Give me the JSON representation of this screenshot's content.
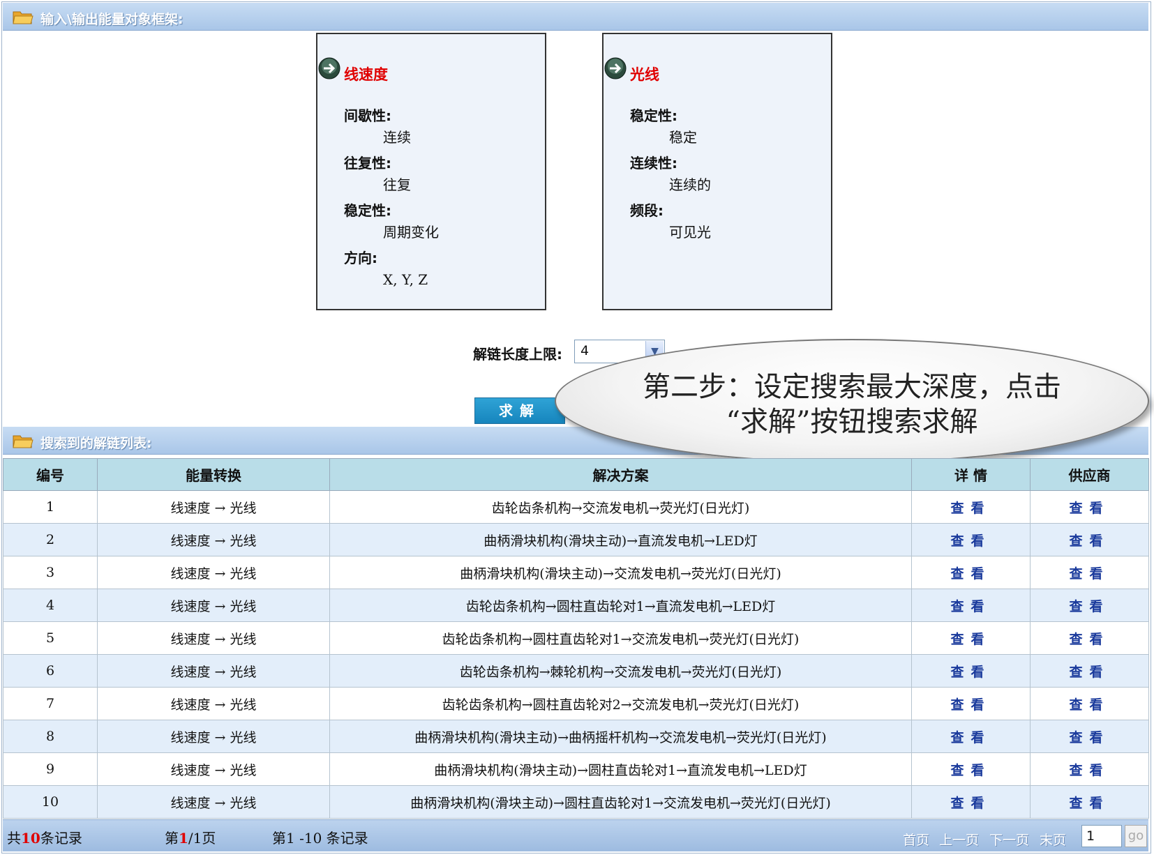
{
  "top_section": {
    "title": "输入\\输出能量对象框架:"
  },
  "input_object": {
    "title": "线速度",
    "properties": [
      {
        "name": "间歇性:",
        "value": "连续"
      },
      {
        "name": "往复性:",
        "value": "往复"
      },
      {
        "name": "稳定性:",
        "value": "周期变化"
      },
      {
        "name": "方向:",
        "value": "X, Y, Z"
      }
    ]
  },
  "output_object": {
    "title": "光线",
    "properties": [
      {
        "name": "稳定性:",
        "value": "稳定"
      },
      {
        "name": "连续性:",
        "value": "连续的"
      },
      {
        "name": "频段:",
        "value": "可见光"
      }
    ]
  },
  "controls": {
    "limit_label": "解链长度上限:",
    "limit_value": "4",
    "solve_label": "求解"
  },
  "callout": {
    "line1": "第二步：设定搜索最大深度，点击",
    "line2": "“求解”按钮搜索求解"
  },
  "results_section": {
    "title": "搜索到的解链列表:"
  },
  "table": {
    "headers": [
      "编号",
      "能量转换",
      "解决方案",
      "详 情",
      "供应商"
    ],
    "link_text": "查看",
    "rows": [
      {
        "id": "1",
        "conversion": "线速度 → 光线",
        "solution": "齿轮齿条机构→交流发电机→荧光灯(日光灯)"
      },
      {
        "id": "2",
        "conversion": "线速度 → 光线",
        "solution": "曲柄滑块机构(滑块主动)→直流发电机→LED灯"
      },
      {
        "id": "3",
        "conversion": "线速度 → 光线",
        "solution": "曲柄滑块机构(滑块主动)→交流发电机→荧光灯(日光灯)"
      },
      {
        "id": "4",
        "conversion": "线速度 → 光线",
        "solution": "齿轮齿条机构→圆柱直齿轮对1→直流发电机→LED灯"
      },
      {
        "id": "5",
        "conversion": "线速度 → 光线",
        "solution": "齿轮齿条机构→圆柱直齿轮对1→交流发电机→荧光灯(日光灯)"
      },
      {
        "id": "6",
        "conversion": "线速度 → 光线",
        "solution": "齿轮齿条机构→棘轮机构→交流发电机→荧光灯(日光灯)"
      },
      {
        "id": "7",
        "conversion": "线速度 → 光线",
        "solution": "齿轮齿条机构→圆柱直齿轮对2→交流发电机→荧光灯(日光灯)"
      },
      {
        "id": "8",
        "conversion": "线速度 → 光线",
        "solution": "曲柄滑块机构(滑块主动)→曲柄摇杆机构→交流发电机→荧光灯(日光灯)"
      },
      {
        "id": "9",
        "conversion": "线速度 → 光线",
        "solution": "曲柄滑块机构(滑块主动)→圆柱直齿轮对1→直流发电机→LED灯"
      },
      {
        "id": "10",
        "conversion": "线速度 → 光线",
        "solution": "曲柄滑块机构(滑块主动)→圆柱直齿轮对1→交流发电机→荧光灯(日光灯)"
      }
    ]
  },
  "footer": {
    "total_prefix": "共",
    "total_count": "10",
    "total_suffix": "条记录",
    "page_prefix": "第",
    "page_current": "1",
    "page_suffix": "/1页",
    "range_text": "第1 -10 条记录",
    "first_page": "首页",
    "prev_page": "上一页",
    "next_page": "下一页",
    "last_page": "末页",
    "page_input_value": "1",
    "go_label": "go"
  },
  "colors": {
    "header_bar": "#a9c6e8",
    "object_title": "#e00000",
    "table_header": "#b9dde8",
    "row_alt": "#e3eefa",
    "link": "#1a3a9c",
    "solve_button": "#1685bd"
  }
}
